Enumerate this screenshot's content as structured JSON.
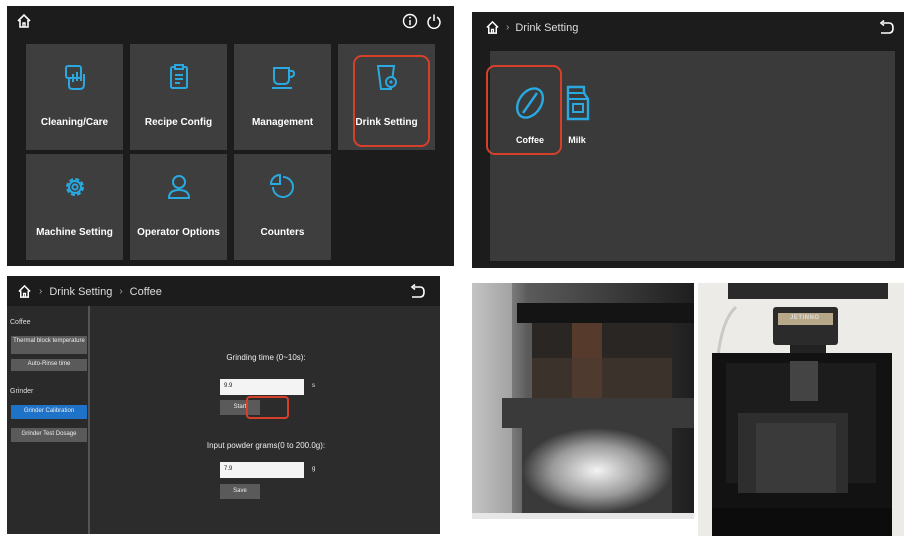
{
  "main_menu": {
    "tiles": [
      {
        "label": "Cleaning/Care",
        "icon": "cleaning-hand-icon"
      },
      {
        "label": "Recipe Config",
        "icon": "clipboard-icon"
      },
      {
        "label": "Management",
        "icon": "cup-icon"
      },
      {
        "label": "Drink Setting",
        "icon": "drink-cup-gear-icon"
      },
      {
        "label": "Machine Setting",
        "icon": "gear-icon"
      },
      {
        "label": "Operator Options",
        "icon": "user-icon"
      },
      {
        "label": "Counters",
        "icon": "pie-chart-icon"
      }
    ],
    "highlighted": "Drink Setting"
  },
  "drink_setting": {
    "breadcrumb": "Drink Setting",
    "drinks": [
      {
        "label": "Coffee",
        "icon": "coffee-bean-icon"
      },
      {
        "label": "Milk",
        "icon": "milk-carton-icon"
      }
    ],
    "highlighted": "Coffee"
  },
  "coffee_setting": {
    "breadcrumb": [
      "Drink Setting",
      "Coffee"
    ],
    "sidebar": {
      "section_coffee": "Coffee",
      "coffee_items": [
        "Thermal block temperature",
        "Auto-Rinse time"
      ],
      "section_grinder": "Grinder",
      "grinder_items": [
        "Grinder Calibration",
        "Grinder Test Dosage"
      ],
      "active": "Grinder Calibration"
    },
    "grinding_title": "Grinding time (0~10s):",
    "grinding_value": "9.9",
    "grinding_unit": "s",
    "start_label": "Start",
    "powder_title": "Input powder grams(0 to 200.0g):",
    "powder_value": "7.9",
    "powder_unit": "g",
    "save_label": "Save"
  },
  "photo_labels": {
    "brand": "JETINNO"
  },
  "colors": {
    "accent": "#29a9e0",
    "highlight": "#d6402a",
    "active": "#1e72c8"
  }
}
